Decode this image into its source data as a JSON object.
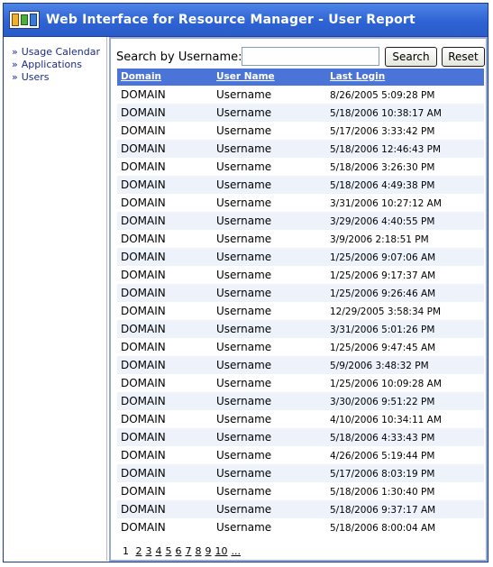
{
  "header": {
    "title": "Web Interface for Resource Manager - User Report"
  },
  "sidebar": {
    "arrow": "»",
    "items": [
      {
        "label": "Usage Calendar"
      },
      {
        "label": "Applications"
      },
      {
        "label": "Users"
      }
    ]
  },
  "search": {
    "label": "Search by Username:",
    "value": "",
    "search_button": "Search",
    "reset_button": "Reset"
  },
  "table": {
    "columns": [
      "Domain",
      "User Name",
      "Last Login"
    ],
    "rows": [
      [
        "DOMAIN",
        "Username",
        "8/26/2005 5:09:28 PM"
      ],
      [
        "DOMAIN",
        "Username",
        "5/18/2006 10:38:17 AM"
      ],
      [
        "DOMAIN",
        "Username",
        "5/17/2006 3:33:42 PM"
      ],
      [
        "DOMAIN",
        "Username",
        "5/18/2006 12:46:43 PM"
      ],
      [
        "DOMAIN",
        "Username",
        "5/18/2006 3:26:30 PM"
      ],
      [
        "DOMAIN",
        "Username",
        "5/18/2006 4:49:38 PM"
      ],
      [
        "DOMAIN",
        "Username",
        "3/31/2006 10:27:12 AM"
      ],
      [
        "DOMAIN",
        "Username",
        "3/29/2006 4:40:55 PM"
      ],
      [
        "DOMAIN",
        "Username",
        "3/9/2006 2:18:51 PM"
      ],
      [
        "DOMAIN",
        "Username",
        "1/25/2006 9:07:06 AM"
      ],
      [
        "DOMAIN",
        "Username",
        "1/25/2006 9:17:37 AM"
      ],
      [
        "DOMAIN",
        "Username",
        "1/25/2006 9:26:46 AM"
      ],
      [
        "DOMAIN",
        "Username",
        "12/29/2005 3:58:34 PM"
      ],
      [
        "DOMAIN",
        "Username",
        "3/31/2006 5:01:26 PM"
      ],
      [
        "DOMAIN",
        "Username",
        "1/25/2006 9:47:45 AM"
      ],
      [
        "DOMAIN",
        "Username",
        "5/9/2006 3:48:32 PM"
      ],
      [
        "DOMAIN",
        "Username",
        "1/25/2006 10:09:28 AM"
      ],
      [
        "DOMAIN",
        "Username",
        "3/30/2006 9:51:22 PM"
      ],
      [
        "DOMAIN",
        "Username",
        "4/10/2006 10:34:11 AM"
      ],
      [
        "DOMAIN",
        "Username",
        "5/18/2006 4:33:43 PM"
      ],
      [
        "DOMAIN",
        "Username",
        "4/26/2006 5:19:44 PM"
      ],
      [
        "DOMAIN",
        "Username",
        "5/17/2006 8:03:19 PM"
      ],
      [
        "DOMAIN",
        "Username",
        "5/18/2006 1:30:40 PM"
      ],
      [
        "DOMAIN",
        "Username",
        "5/18/2006 9:37:17 AM"
      ],
      [
        "DOMAIN",
        "Username",
        "5/18/2006 8:00:04 AM"
      ]
    ]
  },
  "pager": {
    "current": "1",
    "pages": [
      "2",
      "3",
      "4",
      "5",
      "6",
      "7",
      "8",
      "9",
      "10",
      "..."
    ]
  },
  "colors": {
    "title_bar": "#2e63d4",
    "grid_header": "#4a74d8",
    "alt_row": "#eef3fb",
    "link": "#1a2b8a"
  },
  "icons": {
    "app_logo": "resource-manager-logo-icon"
  }
}
